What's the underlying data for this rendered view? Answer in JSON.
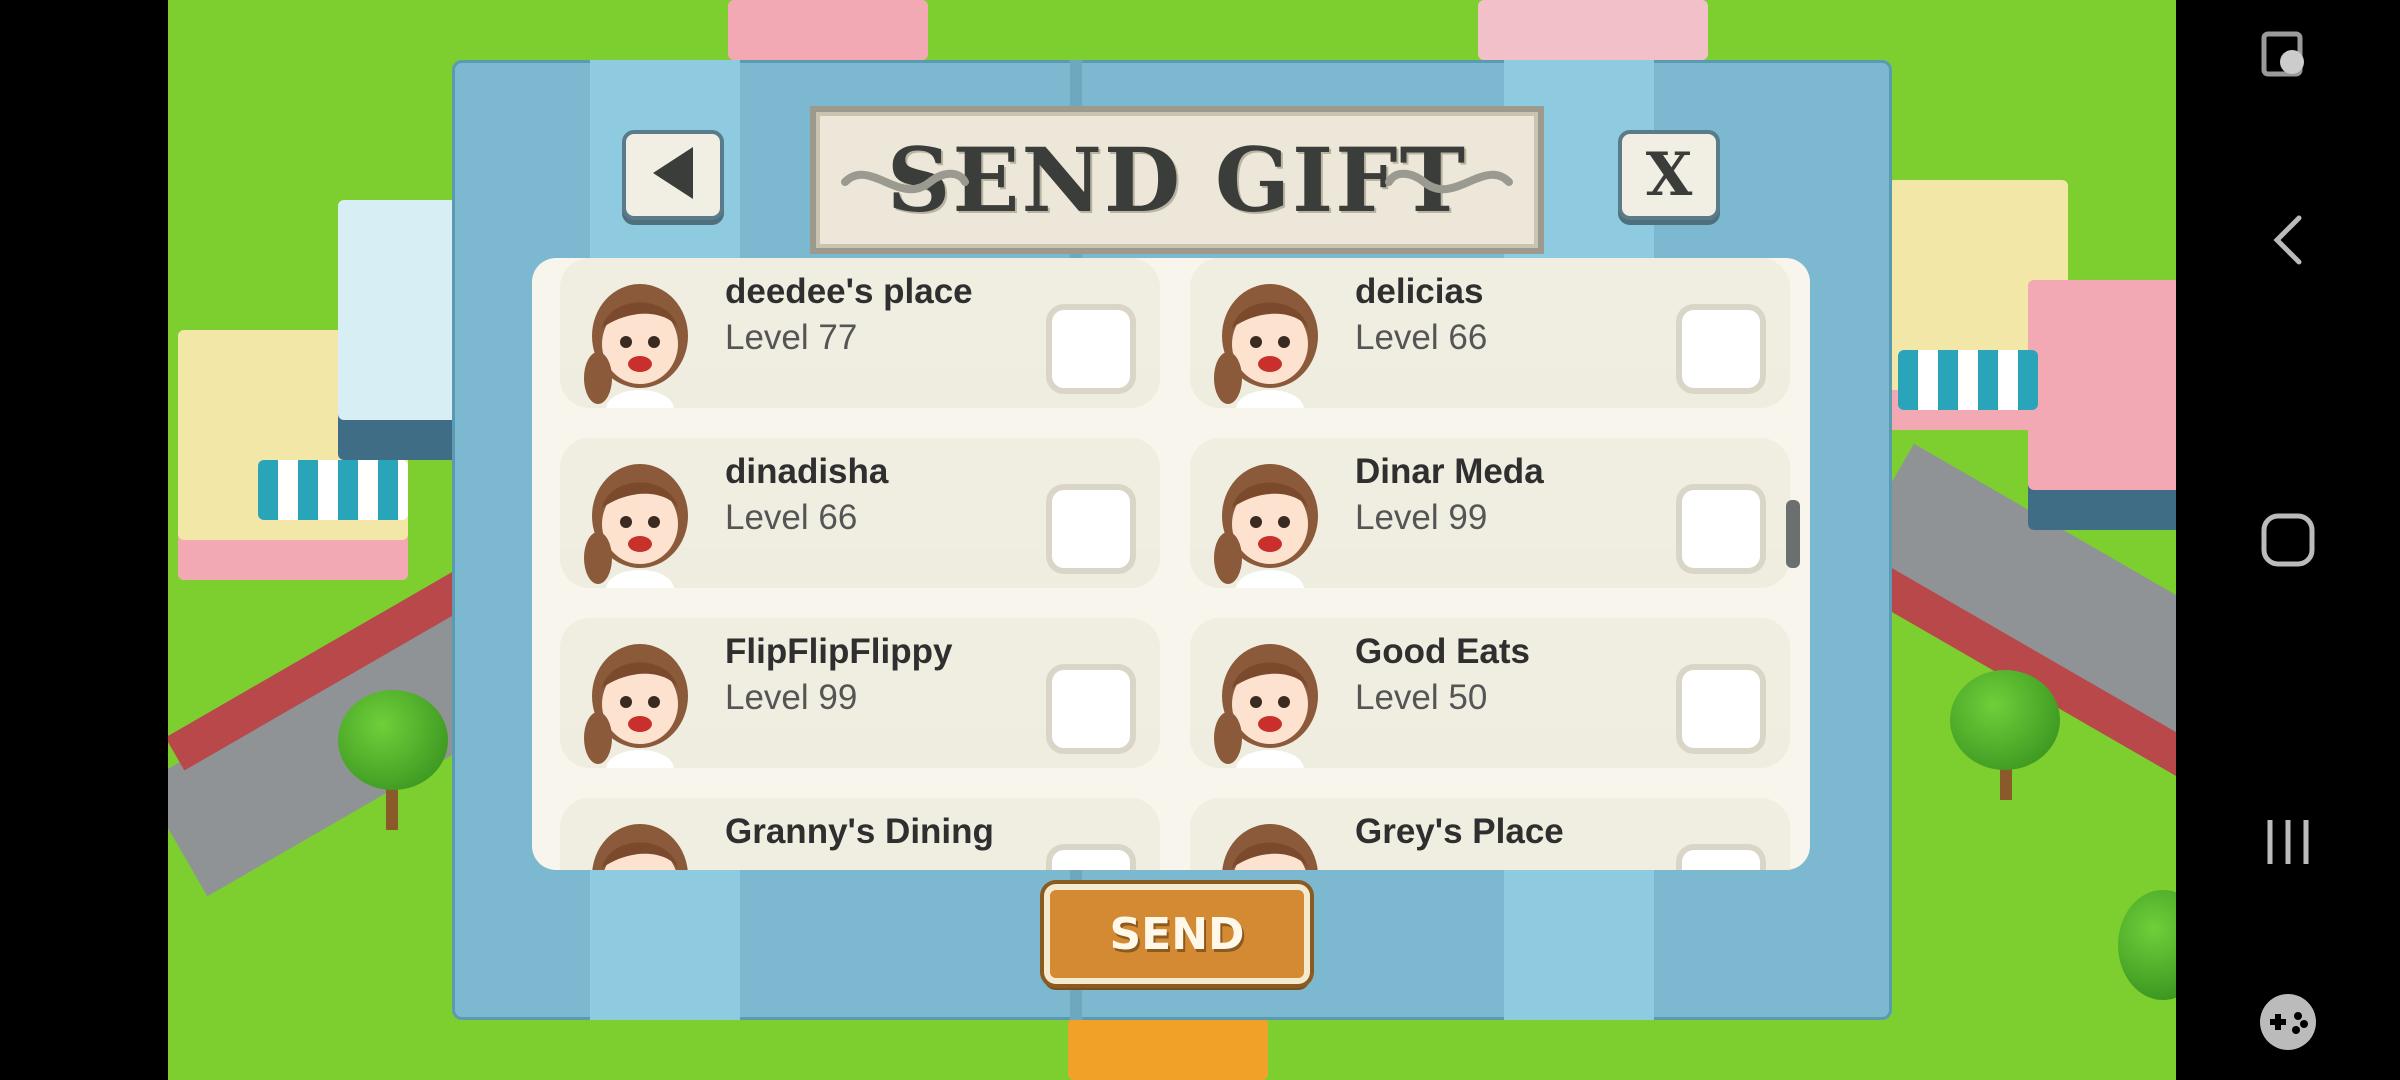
{
  "dialog": {
    "title": "SEND GIFT",
    "close_label": "X",
    "send_label": "SEND"
  },
  "friends": [
    {
      "name": "deedee's place",
      "level": "Level 77"
    },
    {
      "name": "delicias",
      "level": "Level 66"
    },
    {
      "name": "dinadisha",
      "level": "Level 66"
    },
    {
      "name": "Dinar Meda",
      "level": "Level 99"
    },
    {
      "name": "FlipFlipFlippy",
      "level": "Level 99"
    },
    {
      "name": "Good Eats",
      "level": "Level 50"
    },
    {
      "name": "Granny's Dining",
      "level": ""
    },
    {
      "name": "Grey's Place",
      "level": ""
    }
  ],
  "icons": {
    "back": "back-arrow-icon",
    "close": "close-icon",
    "screen_rotate": "screen-rotate-icon",
    "nav_back": "nav-back-icon",
    "nav_home": "nav-home-icon",
    "nav_recents": "nav-recents-icon",
    "game_tools": "game-tools-icon"
  },
  "colors": {
    "dialog": "#7cb8cf",
    "send_button": "#d38a33",
    "grass": "#7ccf2e"
  }
}
